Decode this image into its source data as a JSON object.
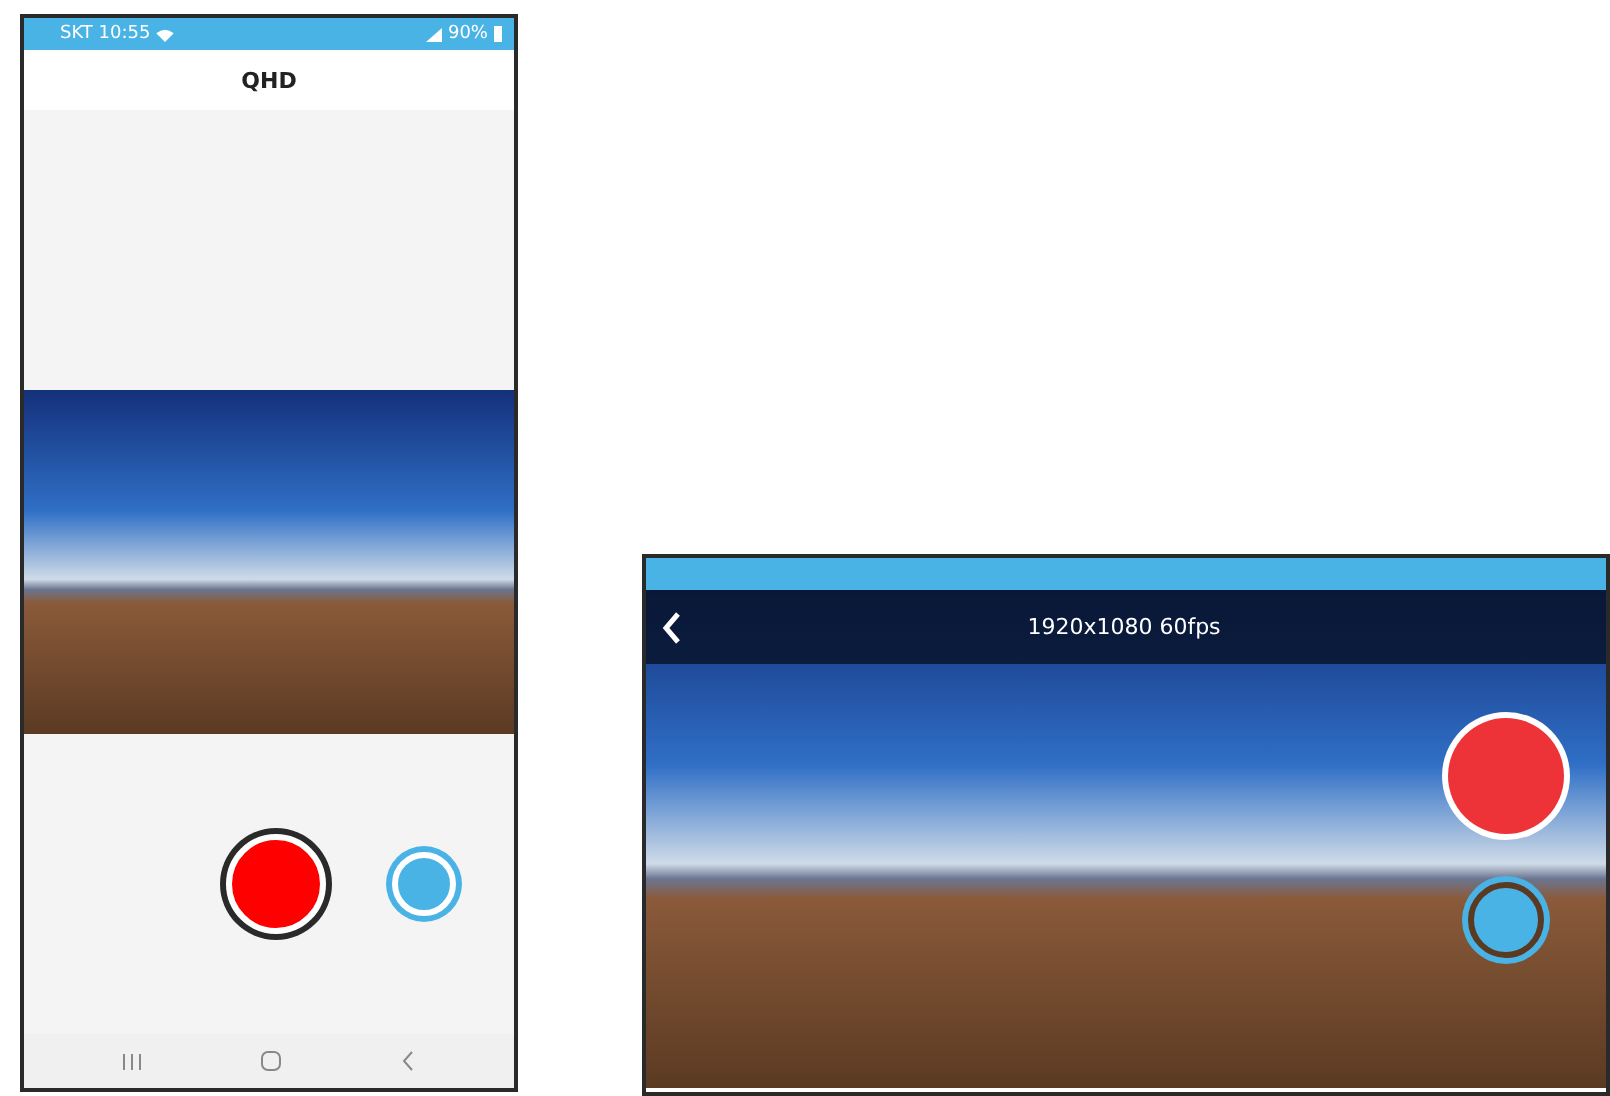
{
  "phone": {
    "status_bar": {
      "carrier_time": "SKT 10:55",
      "battery": "90%"
    },
    "title": "QHD"
  },
  "landscape": {
    "resolution": "1920x1080 60fps"
  }
}
